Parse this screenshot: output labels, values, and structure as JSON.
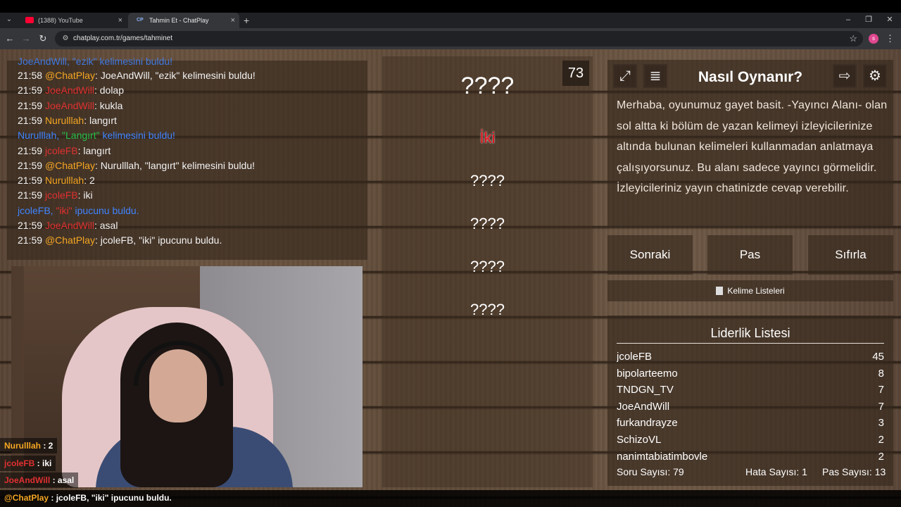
{
  "browser": {
    "tabs": [
      {
        "title": "(1388) YouTube"
      },
      {
        "title": "Tahmin Et - ChatPlay",
        "favicon_text": "CP"
      }
    ],
    "url": "chatplay.com.tr/games/tahminet",
    "profile_initial": "s"
  },
  "chat": {
    "top_partial": "JoeAndWill, \"ezik\" kelimesini buldu!",
    "lines": [
      {
        "time": "21:58",
        "user": "@ChatPlay",
        "text": ": JoeAndWill, \"ezik\" kelimesini buldu!"
      },
      {
        "time": "21:59",
        "user": "JoeAndWill",
        "text": ": dolap"
      },
      {
        "time": "21:59",
        "user": "JoeAndWill",
        "text": ": kukla"
      },
      {
        "time": "21:59",
        "user": "Nurulllah",
        "text": ": langırt"
      },
      {
        "user": "Nurulllah, ",
        "word": "\"Langırt\"",
        "text": " kelimesini buldu!"
      },
      {
        "time": "21:59",
        "user": "jcoleFB",
        "text": ": langırt"
      },
      {
        "time": "21:59",
        "user": "@ChatPlay",
        "text": ": Nurulllah, \"langırt\" kelimesini buldu!"
      },
      {
        "time": "21:59",
        "user": "Nurulllah",
        "text": ": 2"
      },
      {
        "time": "21:59",
        "user": "jcoleFB",
        "text": ": iki"
      },
      {
        "user": "jcoleFB, ",
        "word": "\"iki\"",
        "text": " ipucunu buldu."
      },
      {
        "time": "21:59",
        "user": "JoeAndWill",
        "text": ": asal"
      },
      {
        "time": "21:59",
        "user": "@ChatPlay",
        "text": ": jcoleFB, \"iki\" ipucunu buldu."
      }
    ]
  },
  "overlay_chat": [
    {
      "user": "Nurulllah",
      "text": " : 2"
    },
    {
      "user": "jcoleFB",
      "text": " : iki"
    },
    {
      "user": "JoeAndWill",
      "text": " : asal"
    }
  ],
  "ticker": {
    "user": "@ChatPlay",
    "text": " : jcoleFB, \"iki\" ipucunu buldu."
  },
  "game": {
    "timer": "73",
    "main_word": "????",
    "revealed_clue": "İki",
    "hidden_clues": [
      "????",
      "????",
      "????",
      "????"
    ]
  },
  "howto": {
    "title": "Nasıl Oynanır?",
    "text": "Merhaba, oyunumuz gayet basit. -Yayıncı Alanı- olan sol altta ki bölüm de yazan kelimeyi izleyicilerinize altında bulunan kelimeleri kullanmadan anlatmaya çalışıyorsunuz. Bu alanı sadece yayıncı görmelidir. İzleyicileriniz yayın chatinizde cevap verebilir.",
    "icons": [
      "fullscreen-icon",
      "document-icon",
      "exit-icon",
      "gear-icon"
    ]
  },
  "buttons": {
    "next": "Sonraki",
    "pass": "Pas",
    "reset": "Sıfırla",
    "word_lists": "Kelime Listeleri"
  },
  "leaderboard": {
    "title": "Liderlik Listesi",
    "rows": [
      {
        "name": "jcoleFB",
        "score": "45"
      },
      {
        "name": "bipolarteemo",
        "score": "8"
      },
      {
        "name": "TNDGN_TV",
        "score": "7"
      },
      {
        "name": "JoeAndWill",
        "score": "7"
      },
      {
        "name": "furkandrayze",
        "score": "3"
      },
      {
        "name": "SchizoVL",
        "score": "2"
      },
      {
        "name": "nanimtabiatimboyle",
        "score": "2"
      }
    ]
  },
  "stats": {
    "questions": "Soru Sayısı: 79",
    "errors": "Hata Sayısı: 1",
    "passes": "Pas Sayısı: 13"
  },
  "colors": {
    "orange_user": "#f5a623",
    "red_user": "#e03030",
    "blue_system": "#3f84ff",
    "green_word": "#26c04a",
    "clue_red": "#e0101a"
  }
}
